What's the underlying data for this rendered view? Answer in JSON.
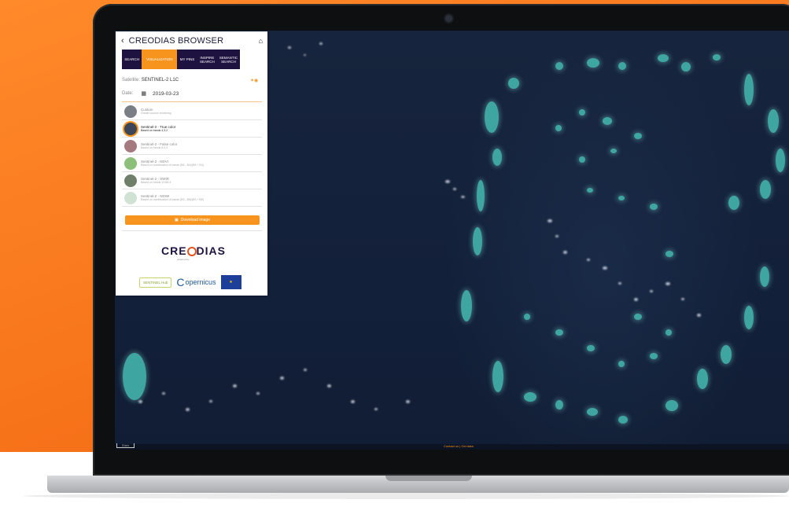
{
  "app": {
    "title": "CREODIAS BROWSER",
    "back_icon": "chevron-left-icon",
    "home_icon": "home-icon"
  },
  "tabs": [
    {
      "label": "SEARCH",
      "active": false
    },
    {
      "label": "VISUALIZATION",
      "active": true
    },
    {
      "label": "MY PINS",
      "active": false
    },
    {
      "label": "INSPIRE SEARCH",
      "active": false
    },
    {
      "label": "SEMANTIC SEARCH",
      "active": false
    }
  ],
  "satellite": {
    "label": "Satellite:",
    "value": "SENTINEL-2 L1C"
  },
  "date": {
    "label": "Date:",
    "value": "2019-03-23",
    "icon": "calendar-icon"
  },
  "layers": [
    {
      "name": "Custom",
      "sub": "Create custom rendering",
      "color": "#7a7f86",
      "selected": false
    },
    {
      "name": "Sentinel-2 - True color",
      "sub": "Based on bands 4,3,2",
      "color": "#3b4658",
      "selected": true
    },
    {
      "name": "Sentinel-2 - False color",
      "sub": "Based on bands 8,4,3",
      "color": "#a57a7e",
      "selected": false
    },
    {
      "name": "Sentinel-2 - NDVI",
      "sub": "Based on combination of bands (B8 - B4)/(B8 + B4)",
      "color": "#8cbf7a",
      "selected": false
    },
    {
      "name": "Sentinel-2 - SWIR",
      "sub": "Based on bands 12,8A,4",
      "color": "#6f7f6a",
      "selected": false
    },
    {
      "name": "Sentinel-2 - NDWI",
      "sub": "Based on combination of bands (B3 - B8)/(B3 + B8)",
      "color": "#cfe2d3",
      "selected": false
    }
  ],
  "download": {
    "label": "Download image",
    "icon": "image-icon"
  },
  "logo": {
    "text": "CREODIAS",
    "sub": "powered by"
  },
  "partners": {
    "sentinel": "SENTINEL Hub",
    "copernicus": "opernicus"
  },
  "map": {
    "scale": "3 km",
    "footer_links": "Contact us | Get data"
  },
  "colors": {
    "accent": "#f7941d",
    "tab_bg": "#1d1240",
    "brand_orange": "#ff7f1f"
  }
}
